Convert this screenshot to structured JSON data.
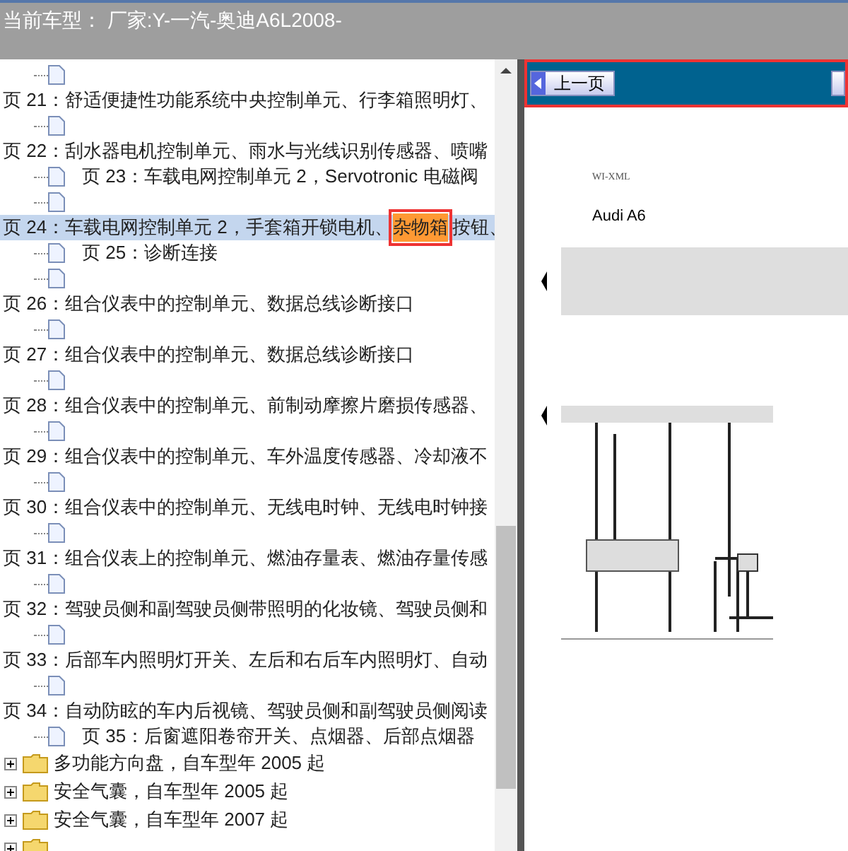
{
  "header": {
    "title": "当前车型：  厂家:Y-一汽-奥迪A6L2008-"
  },
  "tree": [
    {
      "children": [
        {
          "kind": "doc"
        }
      ]
    },
    {
      "kind": "page",
      "label": "页 21：舒适便捷性功能系统中央控制单元、行李箱照明灯、",
      "selected": false,
      "children": [
        {
          "kind": "doc"
        }
      ]
    },
    {
      "kind": "page",
      "label": "页 22：刮水器电机控制单元、雨水与光线识别传感器、喷嘴",
      "selected": false,
      "children": [
        {
          "kind": "doc",
          "label": "页 23：车载电网控制单元 2，Servotronic 电磁阀"
        },
        {
          "kind": "doc"
        }
      ]
    },
    {
      "kind": "page",
      "label": "页 24：车载电网控制单元 2，手套箱开锁电机、",
      "match": "杂物箱",
      "label_rest": "按钮、",
      "selected": true,
      "children": [
        {
          "kind": "doc",
          "label": "页 25：诊断连接"
        },
        {
          "kind": "doc"
        }
      ]
    },
    {
      "kind": "page",
      "label": "页 26：组合仪表中的控制单元、数据总线诊断接口",
      "selected": false,
      "children": [
        {
          "kind": "doc"
        }
      ]
    },
    {
      "kind": "page",
      "label": "页 27：组合仪表中的控制单元、数据总线诊断接口",
      "selected": false,
      "children": [
        {
          "kind": "doc"
        }
      ]
    },
    {
      "kind": "page",
      "label": "页 28：组合仪表中的控制单元、前制动摩擦片磨损传感器、",
      "selected": false,
      "children": [
        {
          "kind": "doc"
        }
      ]
    },
    {
      "kind": "page",
      "label": "页 29：组合仪表中的控制单元、车外温度传感器、冷却液不",
      "selected": false,
      "children": [
        {
          "kind": "doc"
        }
      ]
    },
    {
      "kind": "page",
      "label": "页 30：组合仪表中的控制单元、无线电时钟、无线电时钟接",
      "selected": false,
      "children": [
        {
          "kind": "doc"
        }
      ]
    },
    {
      "kind": "page",
      "label": "页 31：组合仪表上的控制单元、燃油存量表、燃油存量传感",
      "selected": false,
      "children": [
        {
          "kind": "doc"
        }
      ]
    },
    {
      "kind": "page",
      "label": "页 32：驾驶员侧和副驾驶员侧带照明的化妆镜、驾驶员侧和",
      "selected": false,
      "children": [
        {
          "kind": "doc"
        }
      ]
    },
    {
      "kind": "page",
      "label": "页 33：后部车内照明灯开关、左后和右后车内照明灯、自动",
      "selected": false,
      "children": [
        {
          "kind": "doc"
        }
      ]
    },
    {
      "kind": "page",
      "label": "页 34：自动防眩的车内后视镜、驾驶员侧和副驾驶员侧阅读",
      "selected": false,
      "children": [
        {
          "kind": "doc",
          "label": "页 35：后窗遮阳卷帘开关、点烟器、后部点烟器"
        }
      ]
    },
    {
      "kind": "folder",
      "label": "多功能方向盘，自车型年 2005 起",
      "expanded": false
    },
    {
      "kind": "folder",
      "label": "安全气囊，自车型年 2005 起",
      "expanded": false
    },
    {
      "kind": "folder",
      "label": "安全气囊，自车型年 2007 起",
      "expanded": false
    },
    {
      "kind": "folder",
      "expanded": false
    }
  ],
  "viewer": {
    "prev_button": "上一页",
    "doc_code": "WI-XML",
    "doc_title": "Audi A6"
  }
}
